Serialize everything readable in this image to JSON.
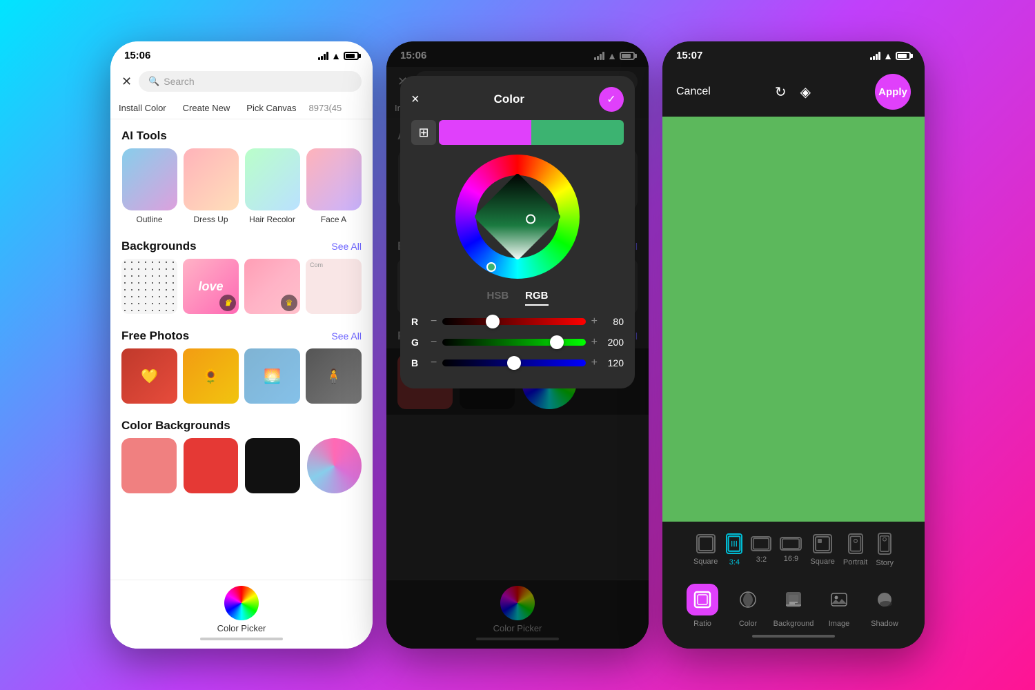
{
  "background": "linear-gradient(135deg, #00e5ff 0%, #c040fb 50%, #ff1493 100%)",
  "phones": [
    {
      "id": "phone1",
      "theme": "light",
      "status": {
        "time": "15:06",
        "signal": true,
        "wifi": true,
        "battery": true
      },
      "searchbar": {
        "close_icon": "×",
        "placeholder": "Search"
      },
      "nav_tabs": [
        "Install Color",
        "Create New",
        "Pick Canvas",
        "8973(45"
      ],
      "ai_tools": {
        "title": "AI Tools",
        "items": [
          {
            "label": "Outline"
          },
          {
            "label": "Dress Up"
          },
          {
            "label": "Hair Recolor"
          },
          {
            "label": "Face A"
          }
        ]
      },
      "backgrounds": {
        "title": "Backgrounds",
        "see_all": "See All"
      },
      "free_photos": {
        "title": "Free Photos",
        "see_all": "See All"
      },
      "color_backgrounds": {
        "title": "Color Backgrounds"
      },
      "bottom_label": "Color Picker"
    },
    {
      "id": "phone2",
      "theme": "dark",
      "status": {
        "time": "15:06"
      },
      "color_dialog": {
        "title": "Color",
        "close_icon": "×",
        "confirm_icon": "✓",
        "mode_tabs": [
          "HSB",
          "RGB"
        ],
        "active_mode": "RGB",
        "r_value": "80",
        "g_value": "200",
        "b_value": "120"
      },
      "bottom_label": "Color Picker"
    },
    {
      "id": "phone3",
      "theme": "dark",
      "status": {
        "time": "15:07"
      },
      "toolbar": {
        "cancel": "Cancel",
        "apply": "Apply"
      },
      "canvas_color": "#5cb85c",
      "ratio_options": [
        {
          "label": "Square",
          "active": false
        },
        {
          "label": "3:4",
          "active": true
        },
        {
          "label": "3:2",
          "active": false
        },
        {
          "label": "16:9",
          "active": false
        },
        {
          "label": "Square",
          "active": false
        },
        {
          "label": "Portrait",
          "active": false
        },
        {
          "label": "Story",
          "active": false
        }
      ],
      "tools": [
        {
          "label": "Ratio",
          "active": true
        },
        {
          "label": "Color",
          "active": false
        },
        {
          "label": "Background",
          "active": false
        },
        {
          "label": "Image",
          "active": false
        },
        {
          "label": "Shadow",
          "active": false
        }
      ]
    }
  ]
}
